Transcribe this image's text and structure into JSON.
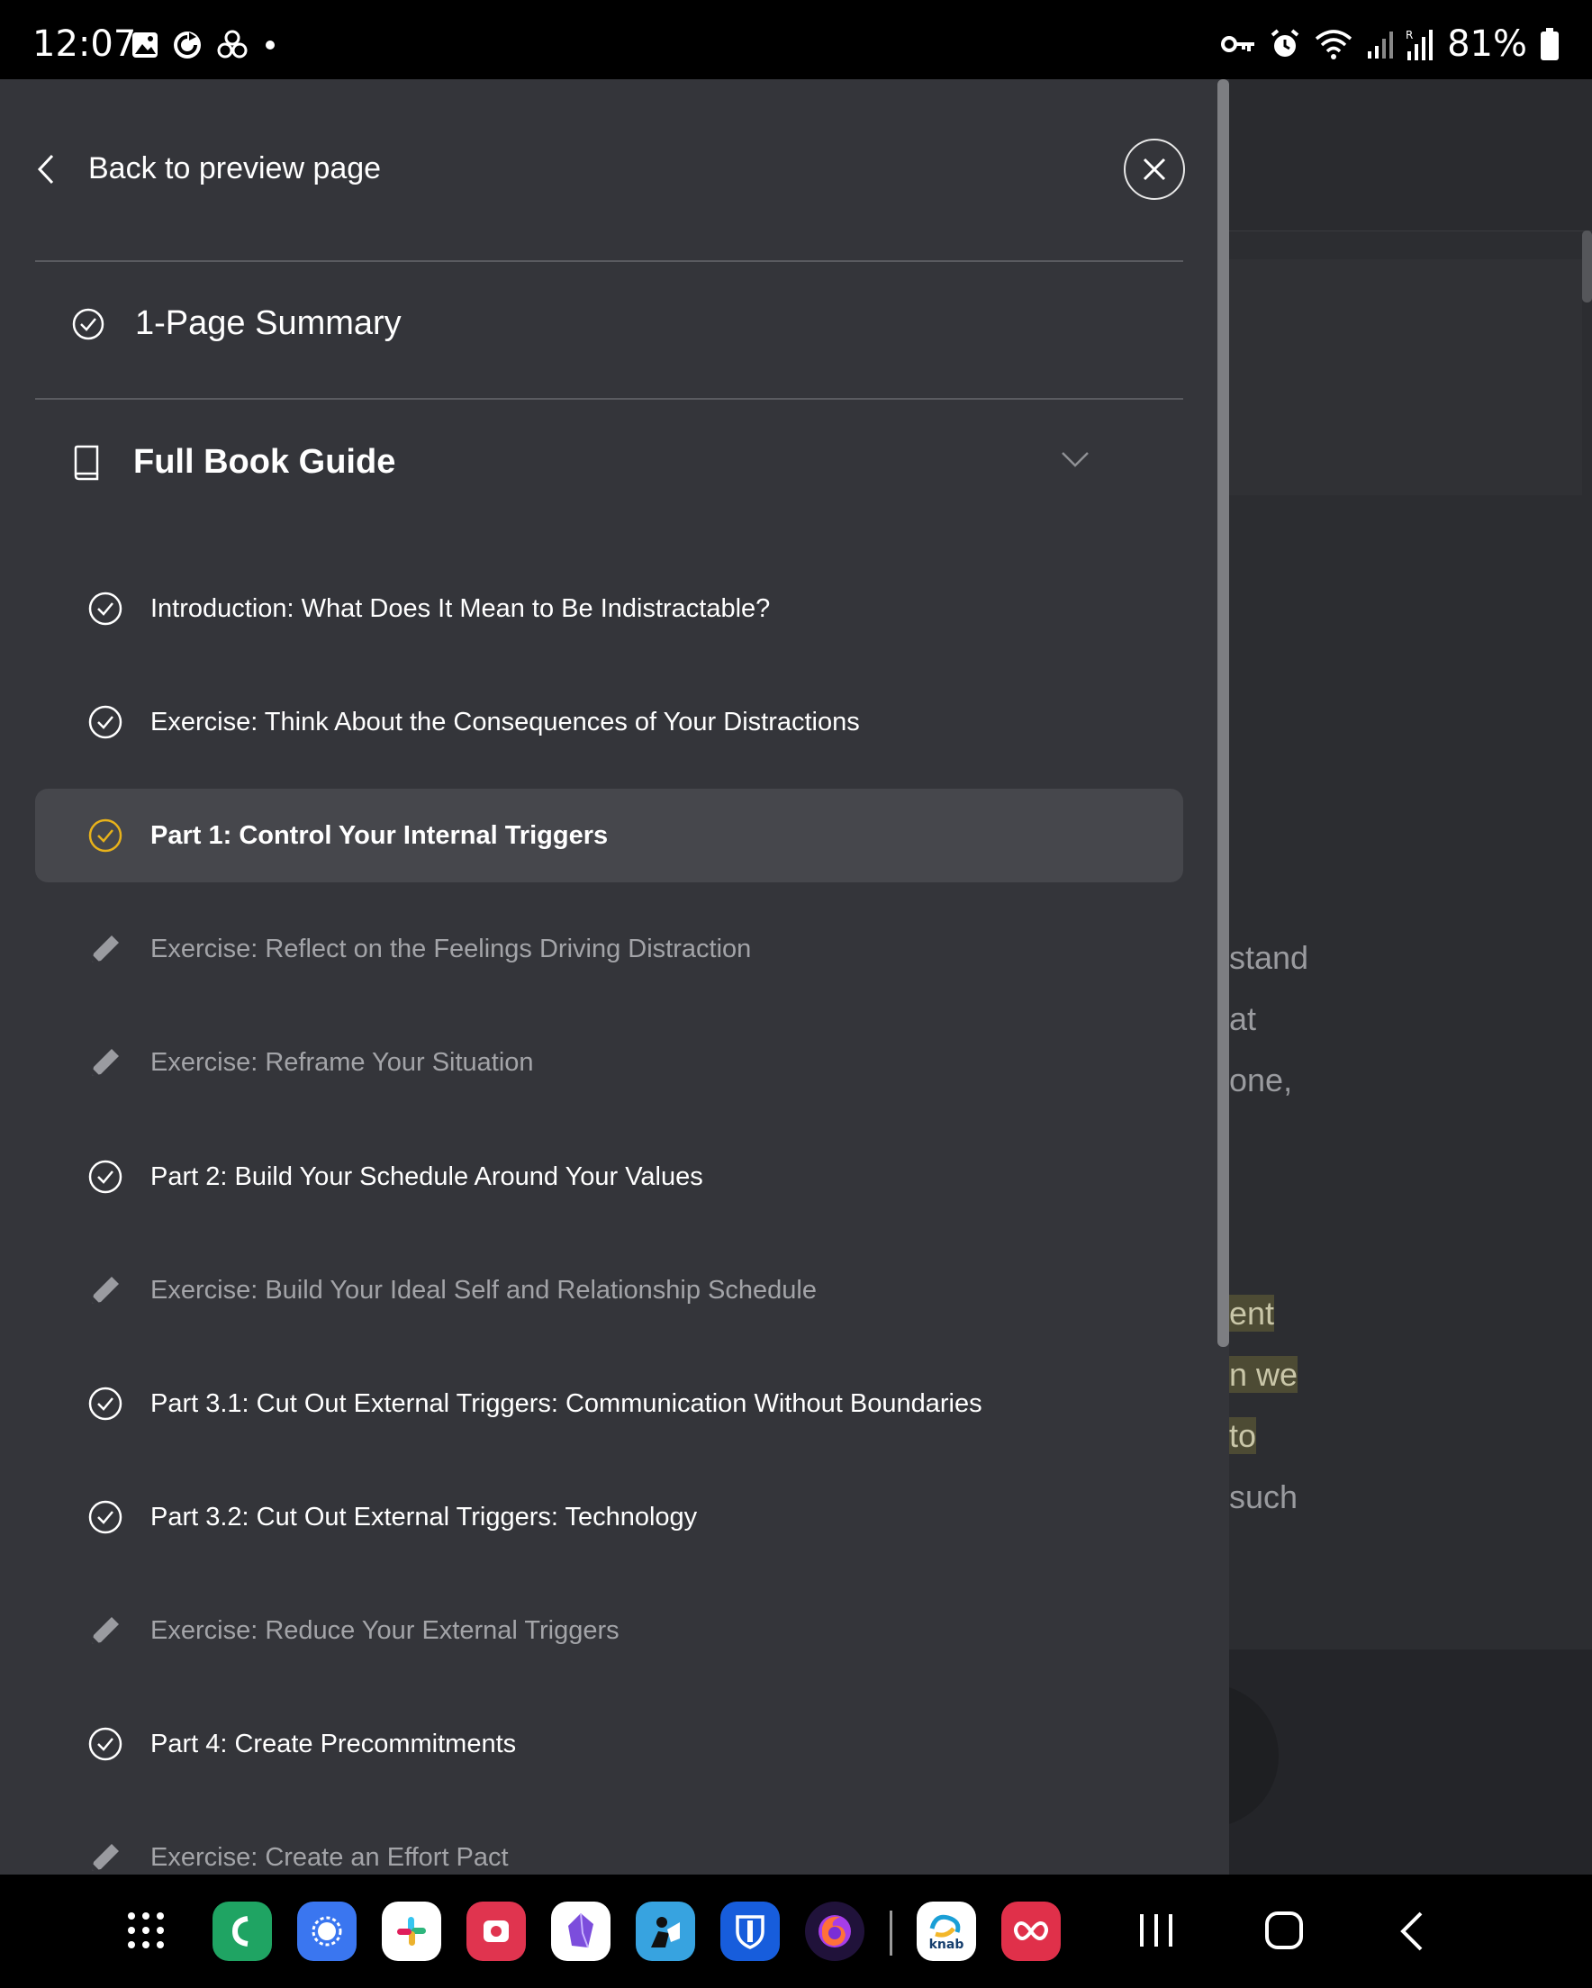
{
  "status_bar": {
    "time": "12:07",
    "battery": "81%",
    "left_icons": [
      "gallery-icon",
      "sync-icon",
      "fan-icon",
      "dot-icon"
    ],
    "right_icons": [
      "vpn-key-icon",
      "alarm-icon",
      "wifi-icon",
      "signal-icon",
      "signal-roaming-icon",
      "battery-icon"
    ]
  },
  "drawer": {
    "back_label": "Back to preview page",
    "summary_label": "1-Page Summary",
    "guide_label": "Full Book Guide",
    "items": [
      {
        "label": "Introduction: What Does It Mean to Be Indistractable?",
        "kind": "check"
      },
      {
        "label": "Exercise: Think About the Consequences of Your Distractions",
        "kind": "check"
      },
      {
        "label": "Part 1: Control Your Internal Triggers",
        "kind": "check-active"
      },
      {
        "label": "Exercise: Reflect on the Feelings Driving Distraction",
        "kind": "pencil"
      },
      {
        "label": "Exercise: Reframe Your Situation",
        "kind": "pencil"
      },
      {
        "label": "Part 2: Build Your Schedule Around Your Values",
        "kind": "check"
      },
      {
        "label": "Exercise: Build Your Ideal Self and Relationship Schedule",
        "kind": "pencil"
      },
      {
        "label": "Part 3.1: Cut Out External Triggers: Communication Without Boundaries",
        "kind": "check"
      },
      {
        "label": "Part 3.2: Cut Out External Triggers: Technology",
        "kind": "check"
      },
      {
        "label": "Exercise: Reduce Your External Triggers",
        "kind": "pencil"
      },
      {
        "label": "Part 4: Create Precommitments",
        "kind": "check"
      },
      {
        "label": "Exercise: Create an Effort Pact",
        "kind": "pencil"
      }
    ]
  },
  "background_page": {
    "fragments": [
      "stand",
      "at",
      "one,"
    ],
    "highlighted_fragments": [
      "ent",
      "n we",
      "to"
    ],
    "after_fragment": "such"
  },
  "colors": {
    "drawer_bg": "#34353a",
    "active_row_bg": "#46474c",
    "active_check": "#e8b21a",
    "highlight_bg": "#4d4b34"
  },
  "nav_bar": {
    "apps": [
      "phone-app",
      "signal-app",
      "slack-app",
      "instagram-app",
      "obsidian-app",
      "kindle-app",
      "bitwarden-app",
      "firefox-app",
      "knab-app",
      "creative-cloud-app"
    ],
    "knab_label": "knab",
    "buttons": [
      "recents-button",
      "home-button",
      "back-button"
    ]
  }
}
